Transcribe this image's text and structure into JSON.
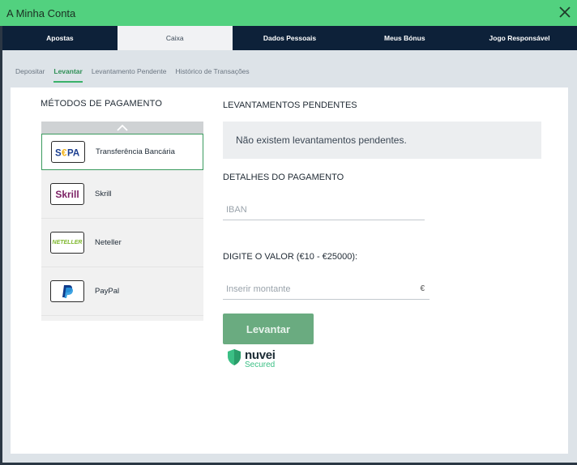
{
  "header": {
    "title": "A Minha Conta"
  },
  "tabs": [
    {
      "label": "Apostas"
    },
    {
      "label": "Caixa"
    },
    {
      "label": "Dados Pessoais"
    },
    {
      "label": "Meus Bónus"
    },
    {
      "label": "Jogo Responsável"
    }
  ],
  "subtabs": [
    {
      "label": "Depositar"
    },
    {
      "label": "Levantar"
    },
    {
      "label": "Levantamento Pendente"
    },
    {
      "label": "Histórico de Transações"
    }
  ],
  "methods": {
    "title": "MÉTODOS DE PAGAMENTO",
    "items": [
      {
        "label": "Transferência Bancária",
        "logo_text": "SEPA"
      },
      {
        "label": "Skrill",
        "logo_text": "Skrill"
      },
      {
        "label": "Neteller",
        "logo_text": "NETELLER"
      },
      {
        "label": "PayPal",
        "logo_text": ""
      }
    ]
  },
  "pending": {
    "title": "LEVANTAMENTOS PENDENTES",
    "message": "Não existem levantamentos pendentes."
  },
  "payment_details": {
    "title": "DETALHES DO PAGAMENTO",
    "iban_placeholder": "IBAN"
  },
  "amount": {
    "title": "DIGITE O VALOR (€10 - €25000):",
    "placeholder": "Inserir montante",
    "currency": "€"
  },
  "submit": {
    "label": "Levantar"
  },
  "badge": {
    "brand": "nuvei",
    "sub": "Secured"
  },
  "colors": {
    "header_green": "#52d17f",
    "tab_bar": "#0d2139",
    "accent_green": "#3ab26a",
    "button_green": "#6aab80"
  }
}
